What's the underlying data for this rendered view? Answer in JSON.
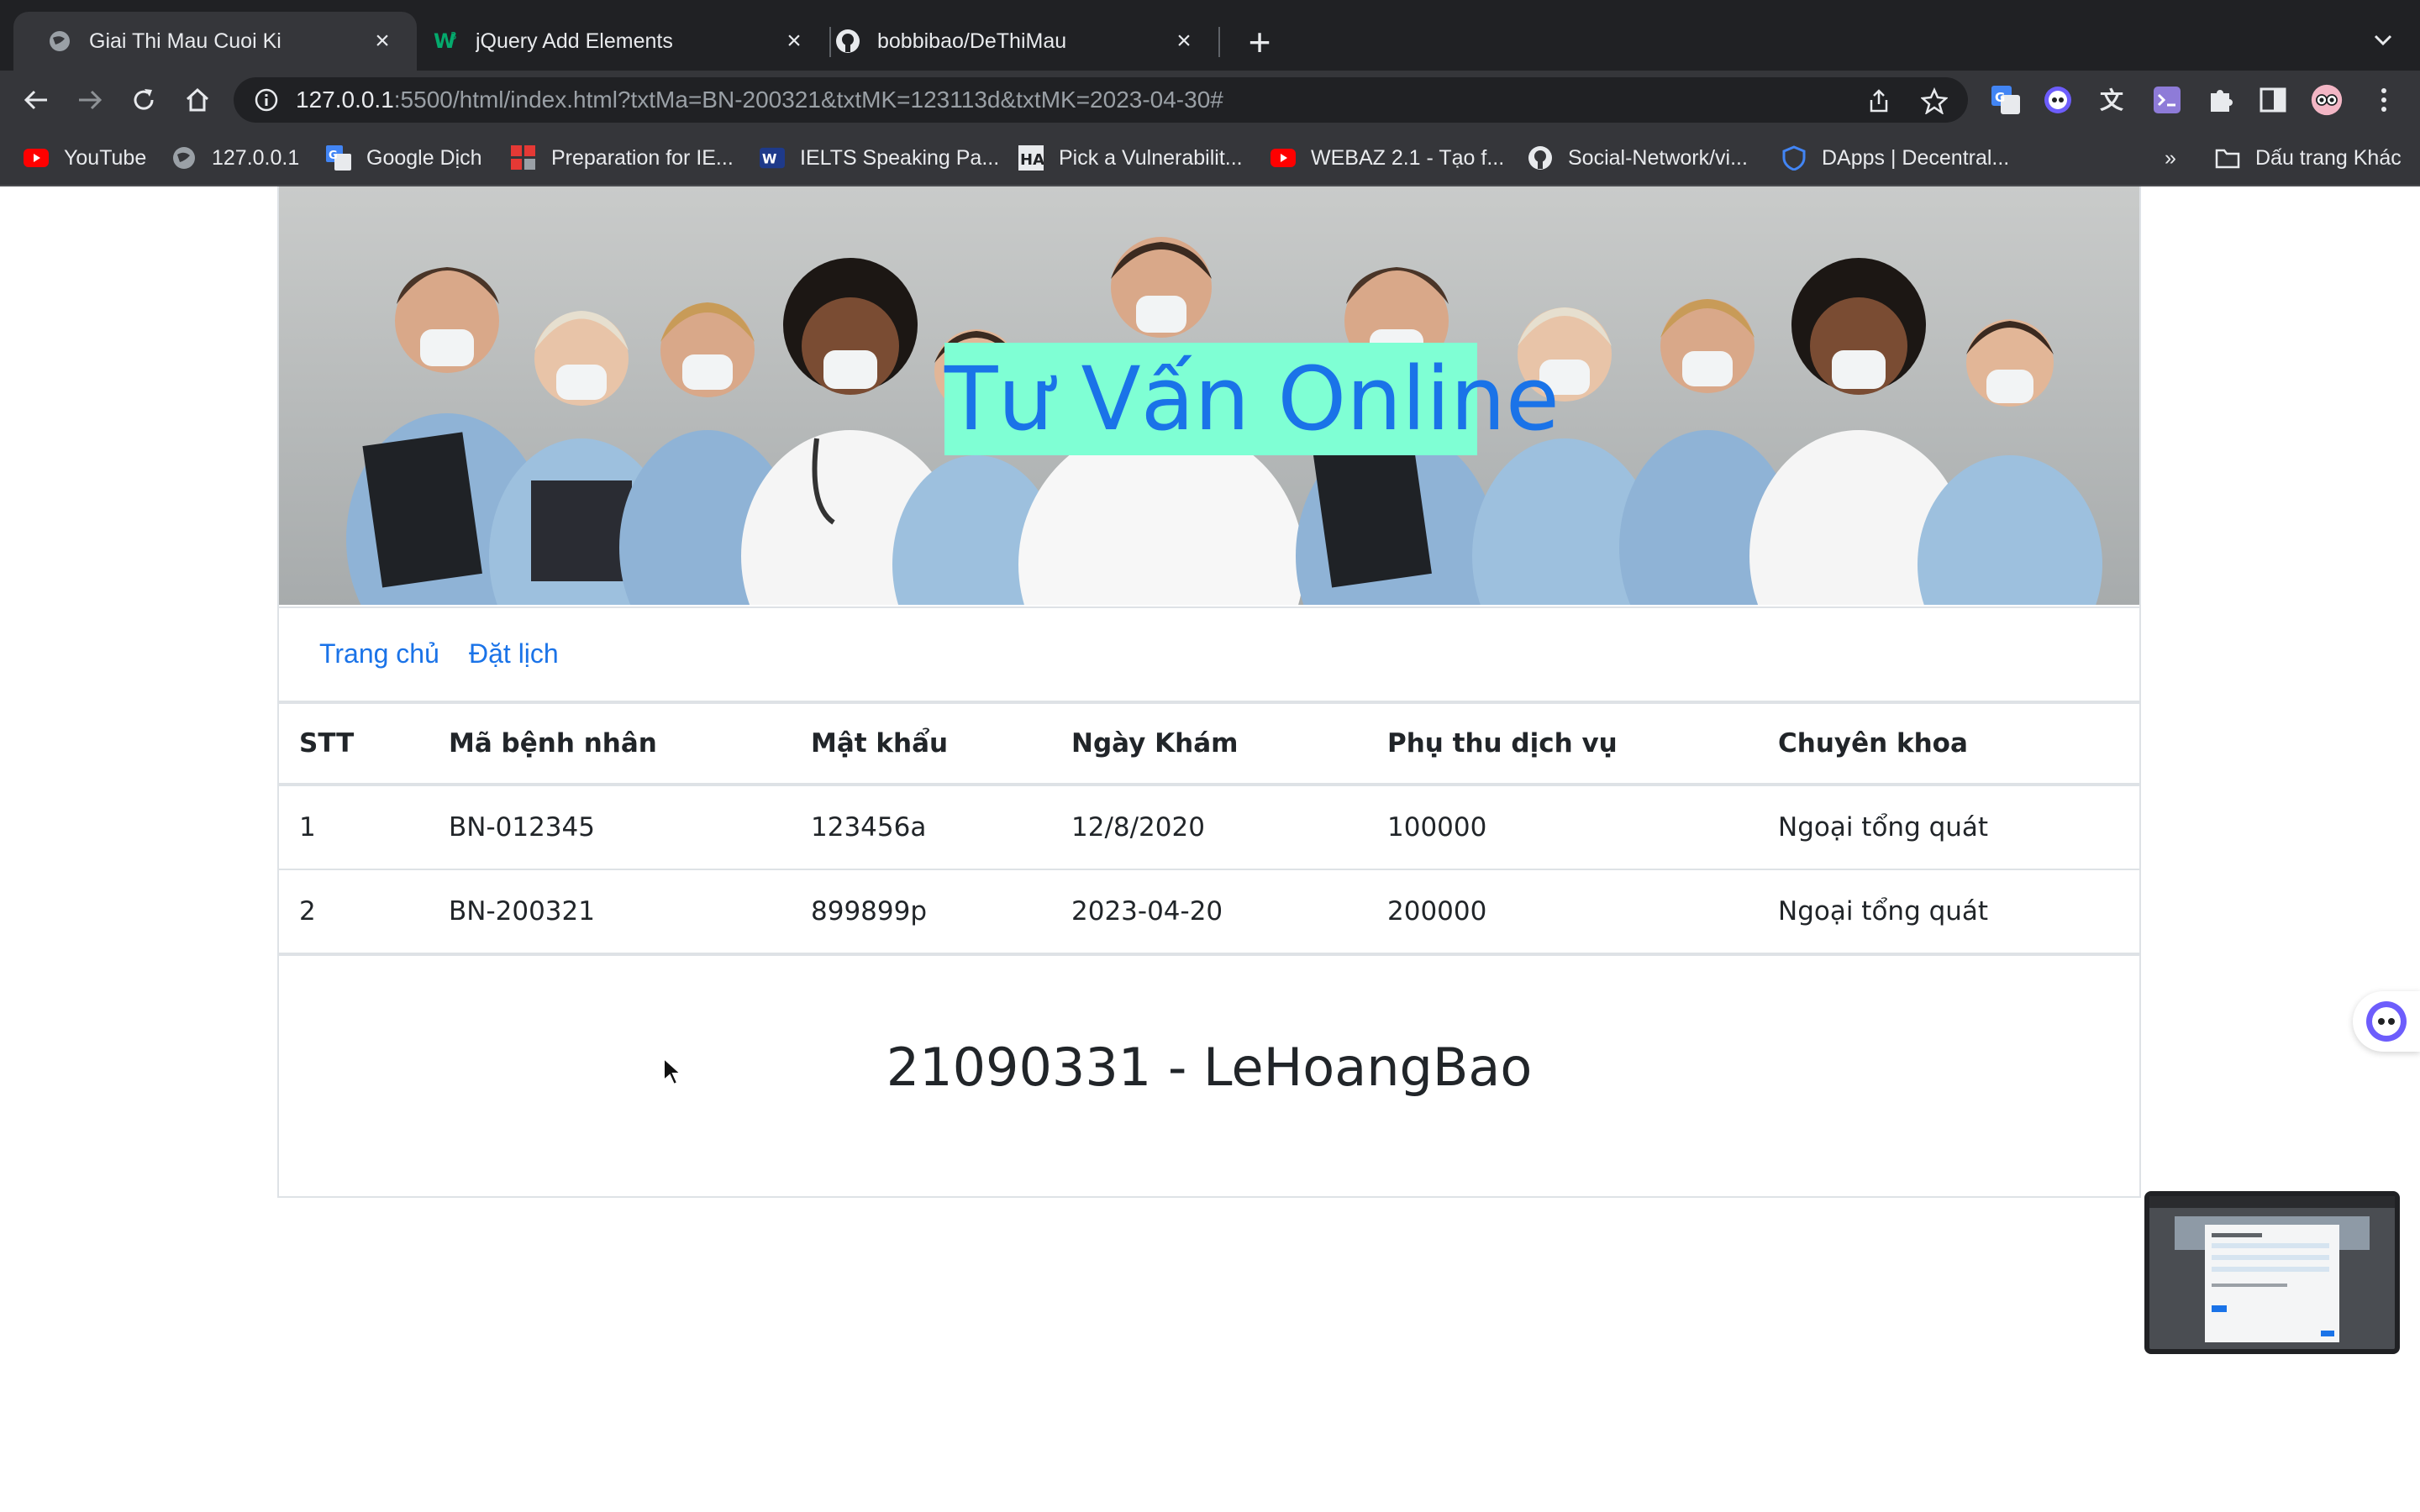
{
  "browser": {
    "tabs": [
      {
        "title": "Giai Thi Mau Cuoi Ki",
        "favicon": "globe-icon",
        "active": true
      },
      {
        "title": "jQuery Add Elements",
        "favicon": "w3schools-icon",
        "active": false
      },
      {
        "title": "bobbibao/DeThiMau",
        "favicon": "github-icon",
        "active": false
      }
    ],
    "new_tab_label": "+",
    "url_host": "127.0.0.1",
    "url_rest": ":5500/html/index.html?txtMa=BN-200321&txtMK=123113d&txtMK=2023-04-30#",
    "bookmarks": [
      {
        "label": "YouTube",
        "icon": "youtube-icon"
      },
      {
        "label": "127.0.0.1",
        "icon": "globe-icon"
      },
      {
        "label": "Google Dịch",
        "icon": "google-translate-icon"
      },
      {
        "label": "Preparation for IE...",
        "icon": "grid-icon"
      },
      {
        "label": "IELTS Speaking Pa...",
        "icon": "ielts-icon"
      },
      {
        "label": "Pick a Vulnerabilit...",
        "icon": "ha-icon"
      },
      {
        "label": "WEBAZ 2.1 - Tạo f...",
        "icon": "youtube-icon"
      },
      {
        "label": "Social-Network/vi...",
        "icon": "github-icon"
      },
      {
        "label": "DApps | Decentral...",
        "icon": "shield-icon"
      }
    ],
    "bookmarks_overflow": "»",
    "other_bookmarks": "Dấu trang Khác",
    "colors": {
      "tabstrip": "#202124",
      "toolbar": "#35363a"
    }
  },
  "page": {
    "banner_title": "Tư Vấn Online",
    "nav": [
      {
        "label": "Trang chủ"
      },
      {
        "label": "Đặt lịch"
      }
    ],
    "table": {
      "headers": [
        "STT",
        "Mã bệnh nhân",
        "Mật khẩu",
        "Ngày Khám",
        "Phụ thu dịch vụ",
        "Chuyên khoa"
      ],
      "rows": [
        [
          "1",
          "BN-012345",
          "123456a",
          "12/8/2020",
          "100000",
          "Ngoại tổng quát"
        ],
        [
          "2",
          "BN-200321",
          "899899p",
          "2023-04-20",
          "200000",
          "Ngoại tổng quát"
        ]
      ]
    },
    "footer": "21090331 - LeHoangBao",
    "colors": {
      "title_bg": "#7fffd4",
      "title_text": "#1a73e8",
      "link": "#1a73e8",
      "border": "#dee2e6"
    }
  }
}
